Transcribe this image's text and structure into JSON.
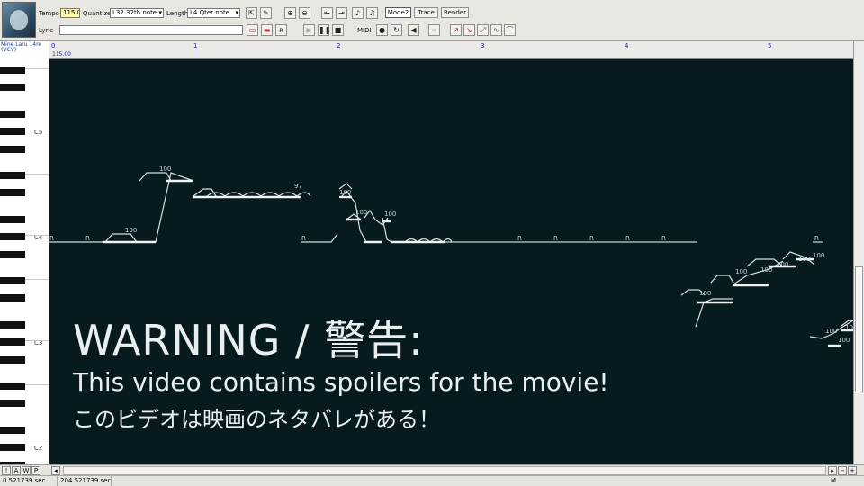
{
  "toolbar": {
    "tempo_label": "Tempo",
    "tempo_value": "115.0",
    "quantize_label": "Quantize",
    "quantize_value": "L32 32th note",
    "length_label": "Length",
    "length_value": "L4  Qter note",
    "mode_button": "Mode2",
    "trace_button": "Trace",
    "render_button": "Render",
    "lyric_label": "Lyric",
    "lyric_value": "",
    "midi_label": "MIDI"
  },
  "ruler": {
    "voicebank": "Mine Laru 14re",
    "voicebank_sub": "(VCV)",
    "tempo_marker": "115.00",
    "bars": [
      "0",
      "1",
      "2",
      "3",
      "4",
      "5"
    ]
  },
  "piano": {
    "octaves": [
      "C5",
      "C4",
      "C3",
      "C2"
    ]
  },
  "notes": {
    "rest_label": "R",
    "velocity_labels": [
      "100",
      "100",
      "97",
      "100",
      "100",
      "100",
      "100",
      "100",
      "100",
      "100",
      "100",
      "100",
      "100",
      "100",
      "100"
    ]
  },
  "overlay": {
    "title": "WARNING / 警告:",
    "line1": "This video contains spoilers for the movie!",
    "line2": "このビデオは映画のネタバレがある！"
  },
  "bottom": {
    "track_buttons": [
      "!",
      "A",
      "W",
      "P"
    ],
    "time_start": "0.521739 sec",
    "time_end": "204.521739 sec",
    "mode_indicator": "M"
  },
  "colors": {
    "canvas_bg": "#071a1d",
    "note_line": "#d8e2e4",
    "pitch_line": "#c9d3d6"
  }
}
